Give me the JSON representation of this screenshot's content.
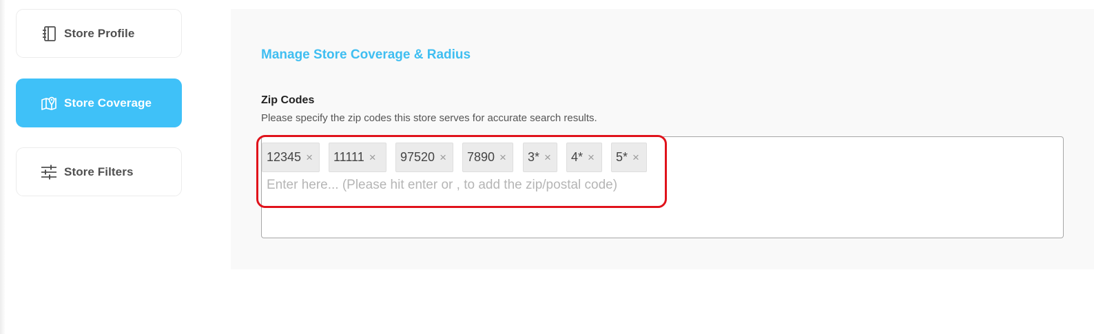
{
  "sidebar": {
    "items": [
      {
        "label": "Store Profile",
        "icon": "notebook-icon",
        "active": false
      },
      {
        "label": "Store Coverage",
        "icon": "map-pin-icon",
        "active": true
      },
      {
        "label": "Store Filters",
        "icon": "sliders-icon",
        "active": false
      }
    ]
  },
  "main": {
    "title": "Manage Store Coverage & Radius",
    "zip_field": {
      "label": "Zip Codes",
      "help": "Please specify the zip codes this store serves for accurate search results.",
      "tags": [
        "12345",
        "11111",
        "97520",
        "7890",
        "3*",
        "4*",
        "5*"
      ],
      "remove_glyph": "×",
      "placeholder": "Enter here... (Please hit enter or , to add the zip/postal code)",
      "value": ""
    }
  },
  "colors": {
    "accent": "#3fc1f8",
    "title": "#3fbef1",
    "highlight": "#e0121b"
  }
}
